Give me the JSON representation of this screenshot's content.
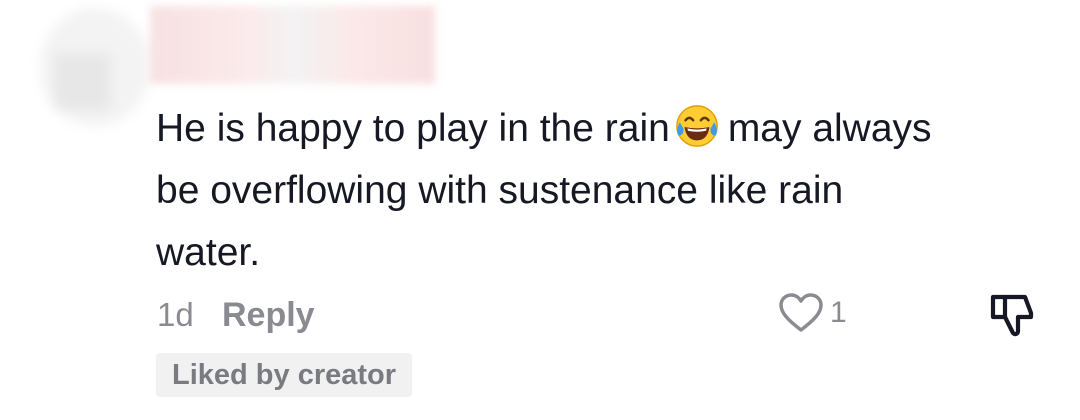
{
  "comment": {
    "text_part1": "He is happy to play in the rain",
    "emoji": "face-with-tears-of-joy-icon",
    "text_part2": "may always be overflowing with sustenance like rain water.",
    "time": "1d",
    "reply_label": "Reply",
    "like_count": "1",
    "liked_by_creator_label": "Liked by creator"
  },
  "colors": {
    "text": "#161823",
    "muted": "#8a8b91",
    "badge_bg": "#f1f1f2"
  }
}
